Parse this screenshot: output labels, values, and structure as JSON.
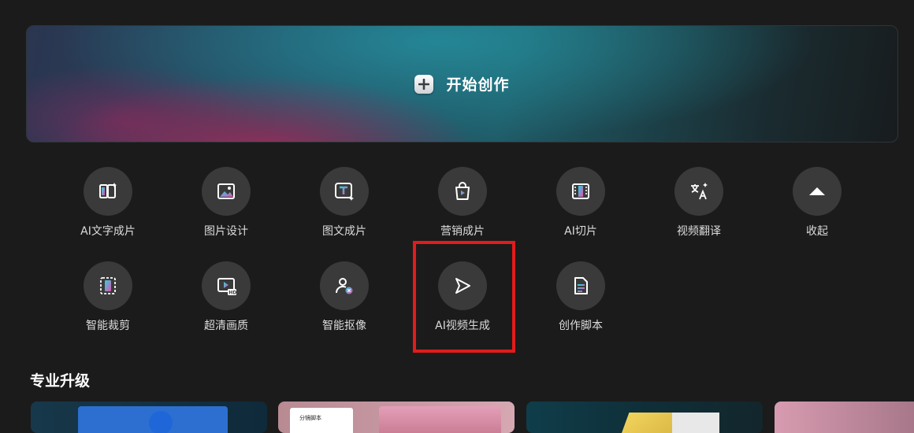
{
  "hero": {
    "label": "开始创作",
    "icon": "plus-icon"
  },
  "tools_row1": [
    {
      "label": "AI文字成片",
      "icon": "ai-text-to-video-icon"
    },
    {
      "label": "图片设计",
      "icon": "image-design-icon"
    },
    {
      "label": "图文成片",
      "icon": "text-image-video-icon"
    },
    {
      "label": "营销成片",
      "icon": "shopping-bag-icon"
    },
    {
      "label": "AI切片",
      "icon": "ai-slice-icon"
    },
    {
      "label": "视频翻译",
      "icon": "translate-icon"
    },
    {
      "label": "收起",
      "icon": "collapse-up-icon"
    }
  ],
  "tools_row2": [
    {
      "label": "智能裁剪",
      "icon": "smart-crop-icon"
    },
    {
      "label": "超清画质",
      "icon": "hd-quality-icon"
    },
    {
      "label": "智能抠像",
      "icon": "portrait-cutout-icon"
    },
    {
      "label": "AI视频生成",
      "icon": "ai-video-generate-icon"
    },
    {
      "label": "创作脚本",
      "icon": "script-document-icon"
    }
  ],
  "section": {
    "title": "专业升级"
  },
  "cards": [
    {
      "name": "template-card-1"
    },
    {
      "name": "template-card-2",
      "text": "分镜脚本"
    },
    {
      "name": "template-card-3"
    },
    {
      "name": "template-card-4"
    }
  ],
  "colors": {
    "background": "#1b1b1c",
    "icon_circle": "#3a3a3b",
    "highlight": "#e31b1b",
    "accent_cyan": "#28c6d6",
    "accent_pink": "#e04fa8"
  }
}
